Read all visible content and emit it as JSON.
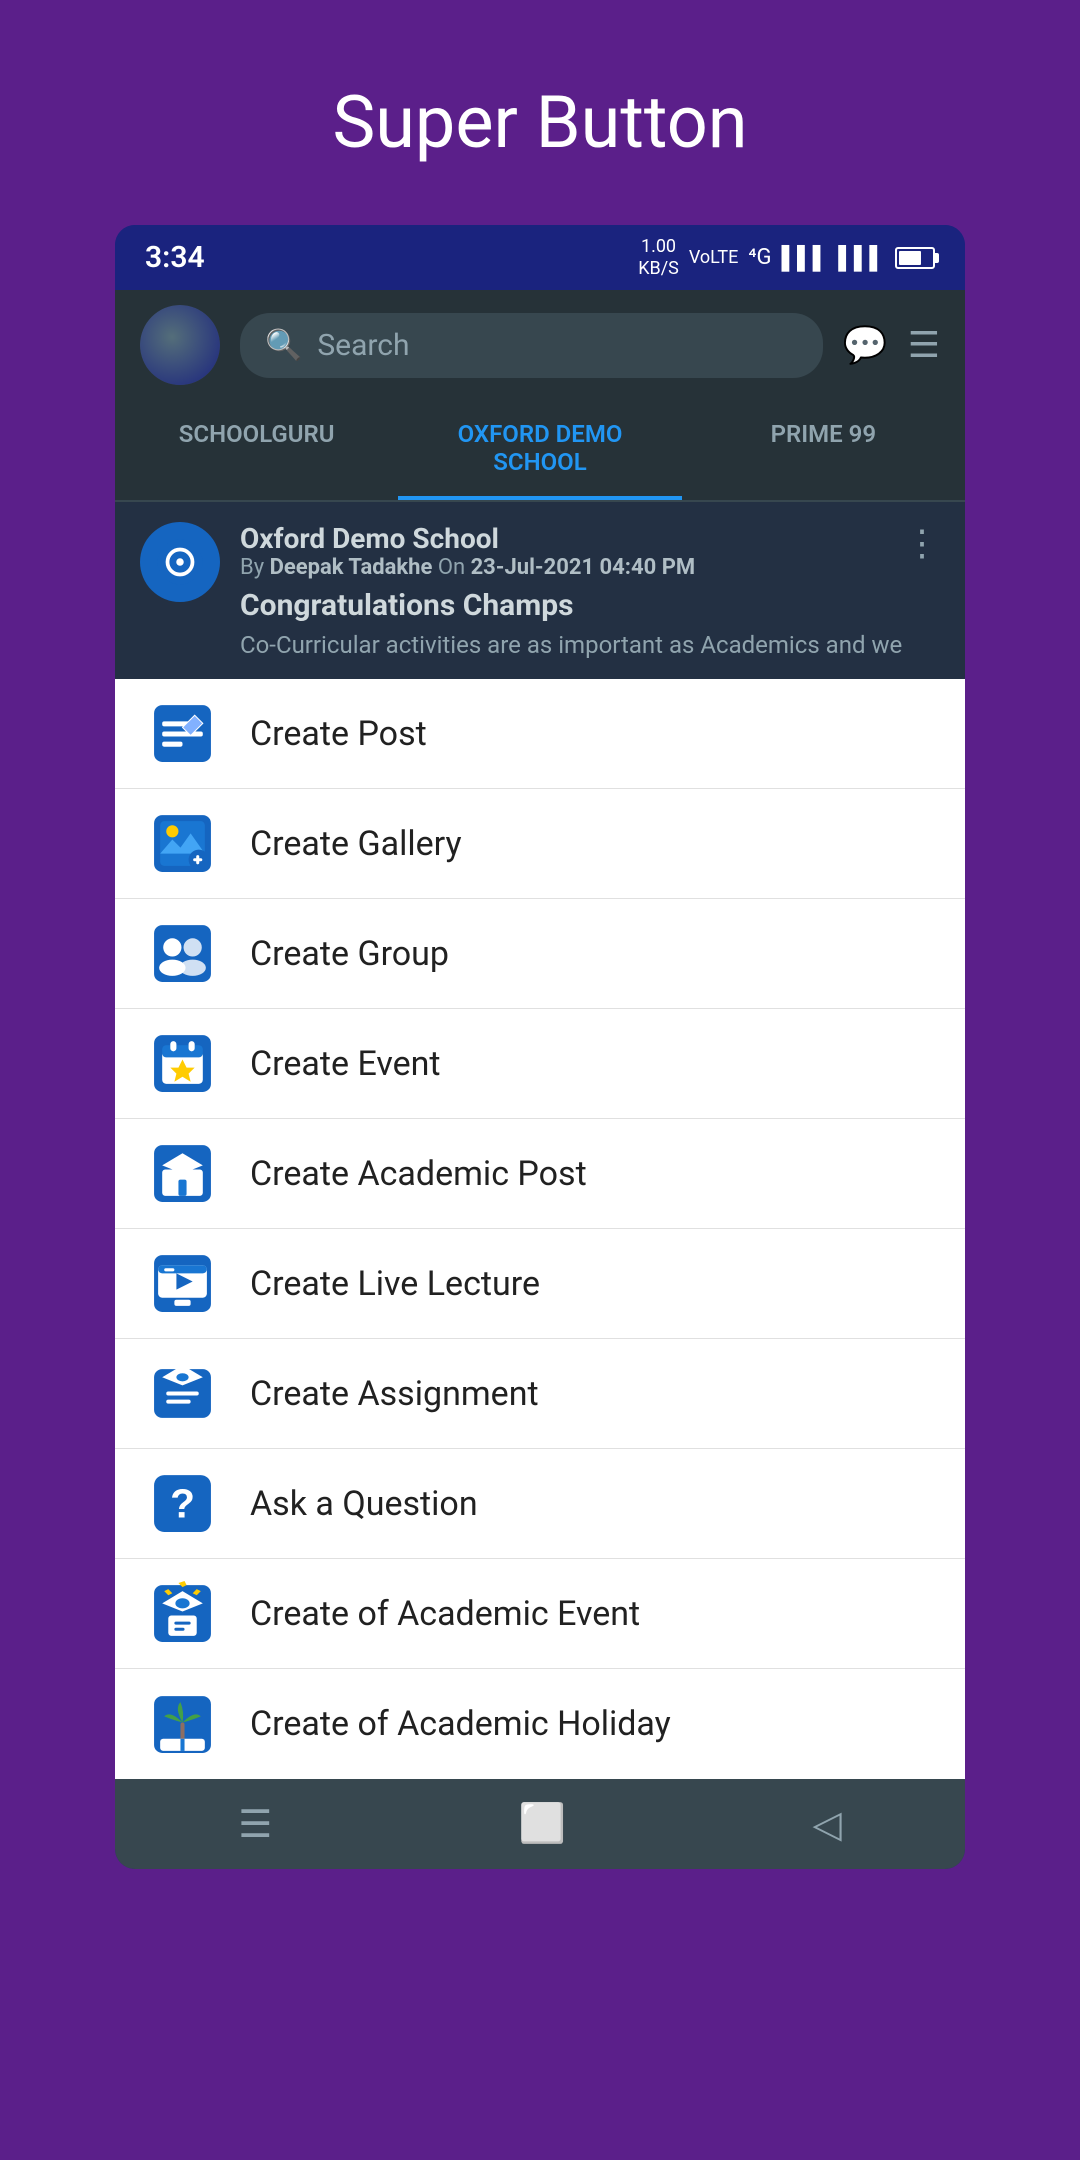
{
  "page": {
    "title": "Super Button"
  },
  "statusBar": {
    "time": "3:34",
    "network": "4G",
    "networkSpeed": "1.00 KB/S",
    "lte": "VoLTE"
  },
  "header": {
    "searchPlaceholder": "Search",
    "chatIcon": "chat-icon",
    "menuIcon": "menu-icon"
  },
  "tabs": [
    {
      "label": "SCHOOLGURU",
      "active": false
    },
    {
      "label": "OXFORD DEMO SCHOOL",
      "active": true
    },
    {
      "label": "PRIME 99",
      "active": false
    }
  ],
  "post": {
    "schoolName": "Oxford Demo School",
    "meta": "By Deepak Tadakhe On 23-Jul-2021 04:40 PM",
    "title": "Congratulations Champs",
    "body": "Co-Curricular activities are as important as Academics and we"
  },
  "menuItems": [
    {
      "id": "create-post",
      "label": "Create Post",
      "icon": "post-icon"
    },
    {
      "id": "create-gallery",
      "label": "Create Gallery",
      "icon": "gallery-icon"
    },
    {
      "id": "create-group",
      "label": "Create Group",
      "icon": "group-icon"
    },
    {
      "id": "create-event",
      "label": "Create Event",
      "icon": "event-icon"
    },
    {
      "id": "create-academic-post",
      "label": "Create Academic Post",
      "icon": "academic-post-icon"
    },
    {
      "id": "create-live-lecture",
      "label": "Create Live Lecture",
      "icon": "live-lecture-icon"
    },
    {
      "id": "create-assignment",
      "label": "Create Assignment",
      "icon": "assignment-icon"
    },
    {
      "id": "ask-question",
      "label": "Ask a Question",
      "icon": "question-icon"
    },
    {
      "id": "create-academic-event",
      "label": "Create of Academic Event",
      "icon": "academic-event-icon"
    },
    {
      "id": "create-academic-holiday",
      "label": "Create of Academic Holiday",
      "icon": "academic-holiday-icon"
    }
  ],
  "bottomNav": {
    "menuIcon": "hamburger-nav-icon",
    "homeIcon": "square-nav-icon",
    "backIcon": "back-nav-icon"
  },
  "colors": {
    "primary": "#5b1f8a",
    "accent": "#2196f3",
    "iconBlue": "#1565c0"
  }
}
